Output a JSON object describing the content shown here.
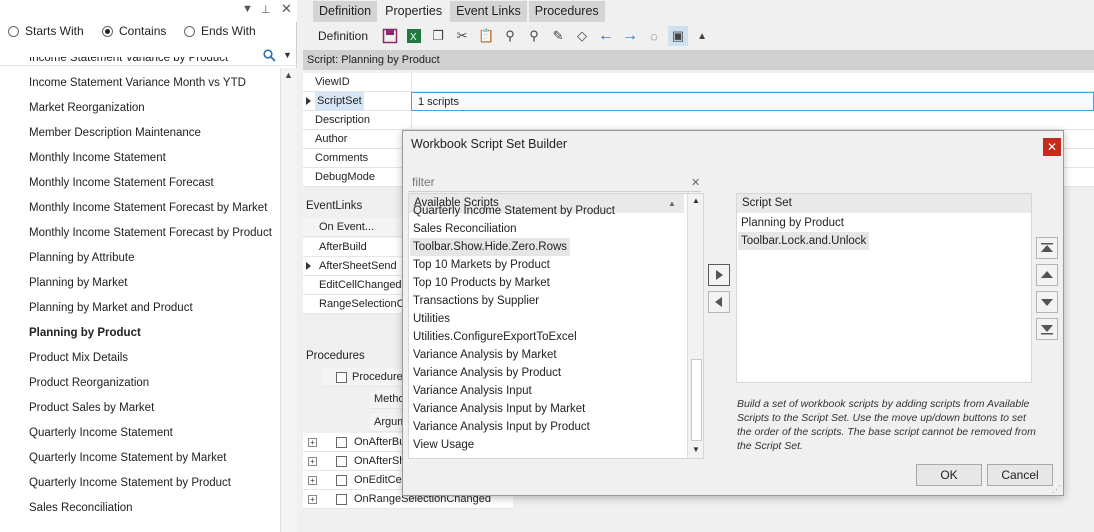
{
  "left_panel": {
    "radio_options": [
      {
        "label": "Starts With",
        "selected": false
      },
      {
        "label": "Contains",
        "selected": true
      },
      {
        "label": "Ends With",
        "selected": false
      }
    ],
    "items": [
      "Income Statement Variance by Product",
      "Income Statement Variance Month vs YTD",
      "Market Reorganization",
      "Member Description Maintenance",
      "Monthly Income Statement",
      "Monthly Income Statement Forecast",
      "Monthly Income Statement Forecast by Market",
      "Monthly Income Statement Forecast by Product",
      "Planning by Attribute",
      "Planning by Market",
      "Planning by Market and Product",
      "Planning by Product",
      "Product Mix Details",
      "Product Reorganization",
      "Product Sales by Market",
      "Quarterly Income Statement",
      "Quarterly Income Statement by Market",
      "Quarterly Income Statement by Product",
      "Sales Reconciliation"
    ],
    "selected_item": "Planning by Product"
  },
  "tabs": [
    "Definition",
    "Properties",
    "Event Links",
    "Procedures"
  ],
  "active_tab": "Properties",
  "toolbar": {
    "definition_label": "Definition"
  },
  "script_header": "Script: Planning by Product",
  "properties": [
    {
      "key": "ViewID",
      "value": ""
    },
    {
      "key": "ScriptSet",
      "value": "1 scripts"
    },
    {
      "key": "Description",
      "value": ""
    },
    {
      "key": "Author",
      "value": ""
    },
    {
      "key": "Comments",
      "value": ""
    },
    {
      "key": "DebugMode",
      "value": ""
    }
  ],
  "event_links": {
    "title": "EventLinks",
    "header": "On Event...",
    "rows": [
      "AfterBuild",
      "AfterSheetSend",
      "EditCellChanged",
      "RangeSelectionC"
    ]
  },
  "procedures": {
    "title": "Procedures",
    "header": "Procedure",
    "subheaders": [
      "Metho",
      "Argum"
    ],
    "rows": [
      "OnAfterBu",
      "OnAfterSh",
      "OnEditCe",
      "OnRangeSelectionChanged"
    ]
  },
  "dialog": {
    "title": "Workbook Script Set Builder",
    "filter_placeholder": "filter",
    "available_header": "Available Scripts",
    "available_items": [
      "Quarterly Income Statement by Product",
      "Sales Reconciliation",
      "Toolbar.Show.Hide.Zero.Rows",
      "Top 10 Markets by Product",
      "Top 10 Products by Market",
      "Transactions by Supplier",
      "Utilities",
      "Utilities.ConfigureExportToExcel",
      "Variance Analysis by Market",
      "Variance Analysis by Product",
      "Variance Analysis Input",
      "Variance Analysis Input by Market",
      "Variance Analysis Input by Product",
      "View Usage"
    ],
    "available_highlight": "Toolbar.Show.Hide.Zero.Rows",
    "set_header": "Script Set",
    "set_items": [
      "Planning by Product",
      "Toolbar.Lock.and.Unlock"
    ],
    "set_highlight": "Toolbar.Lock.and.Unlock",
    "help_text": "Build a set of workbook scripts by adding scripts from Available Scripts to the Script Set. Use the move up/down buttons to set the order of the scripts. The base script cannot be removed from the Script Set.",
    "ok_label": "OK",
    "cancel_label": "Cancel"
  },
  "colors": {
    "close": "#c42b1c",
    "selection_border": "#4aa0d8",
    "tab_inactive": "#d4d4d4",
    "header_bar": "#d0d0d0"
  }
}
